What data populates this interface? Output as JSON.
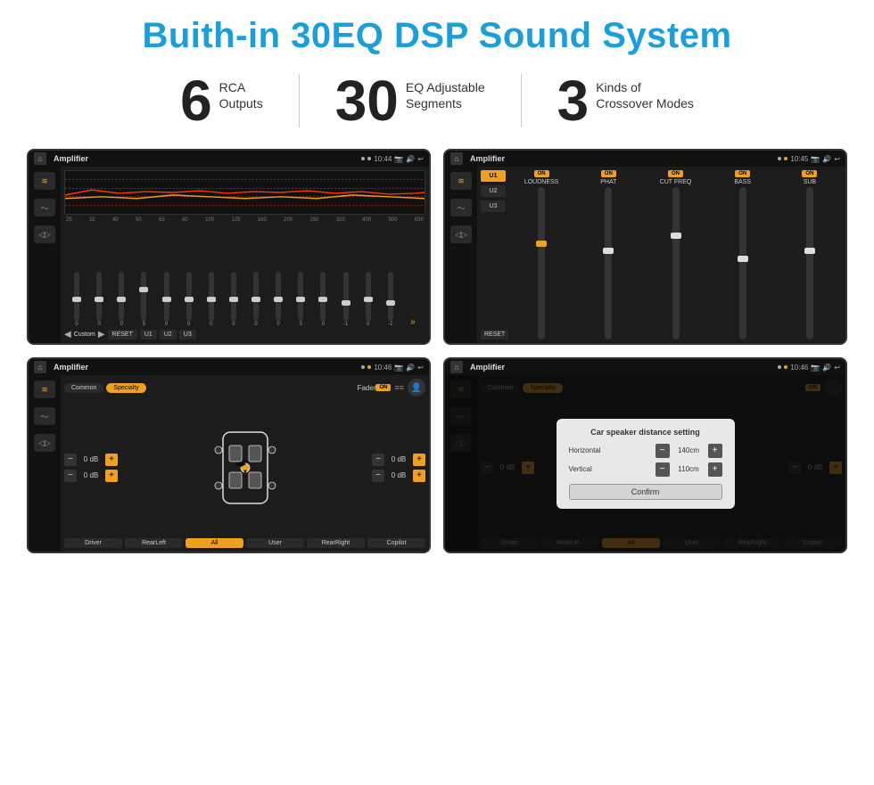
{
  "page": {
    "title": "Buith-in 30EQ DSP Sound System",
    "title_color": "#1a9fdb",
    "stats": [
      {
        "number": "6",
        "label": "RCA\nOutputs"
      },
      {
        "number": "30",
        "label": "EQ Adjustable\nSegments"
      },
      {
        "number": "3",
        "label": "Kinds of\nCrossover Modes"
      }
    ]
  },
  "screens": {
    "screen1": {
      "status_title": "Amplifier",
      "status_time": "10:44",
      "freq_labels": [
        "25",
        "32",
        "40",
        "50",
        "63",
        "80",
        "100",
        "125",
        "160",
        "200",
        "250",
        "320",
        "400",
        "500",
        "630"
      ],
      "slider_values": [
        "0",
        "0",
        "0",
        "5",
        "0",
        "0",
        "0",
        "0",
        "0",
        "0",
        "0",
        "0",
        "-1",
        "0",
        "-1"
      ],
      "buttons": [
        "RESET",
        "U1",
        "U2",
        "U3"
      ],
      "custom_label": "Custom"
    },
    "screen2": {
      "status_title": "Amplifier",
      "status_time": "10:45",
      "presets": [
        "U1",
        "U2",
        "U3"
      ],
      "channels": [
        {
          "name": "LOUDNESS",
          "on": true
        },
        {
          "name": "PHAT",
          "on": true
        },
        {
          "name": "CUT FREQ",
          "on": true
        },
        {
          "name": "BASS",
          "on": true
        },
        {
          "name": "SUB",
          "on": true
        }
      ],
      "reset_label": "RESET"
    },
    "screen3": {
      "status_title": "Amplifier",
      "status_time": "10:46",
      "tabs": [
        "Common",
        "Specialty"
      ],
      "active_tab": "Specialty",
      "fader_label": "Fader",
      "fader_on": "ON",
      "db_values": [
        "0 dB",
        "0 dB",
        "0 dB",
        "0 dB"
      ],
      "bottom_buttons": [
        "Driver",
        "RearLeft",
        "All",
        "User",
        "RearRight",
        "Copilot"
      ]
    },
    "screen4": {
      "status_title": "Amplifier",
      "status_time": "10:46",
      "tabs": [
        "Common",
        "Specialty"
      ],
      "dialog": {
        "title": "Car speaker distance setting",
        "horizontal_label": "Horizontal",
        "horizontal_value": "140cm",
        "vertical_label": "Vertical",
        "vertical_value": "110cm",
        "confirm_button": "Confirm"
      },
      "bottom_buttons": [
        "Driver",
        "RearLef...",
        "All",
        "User",
        "RearRight",
        "Copilot"
      ]
    }
  }
}
